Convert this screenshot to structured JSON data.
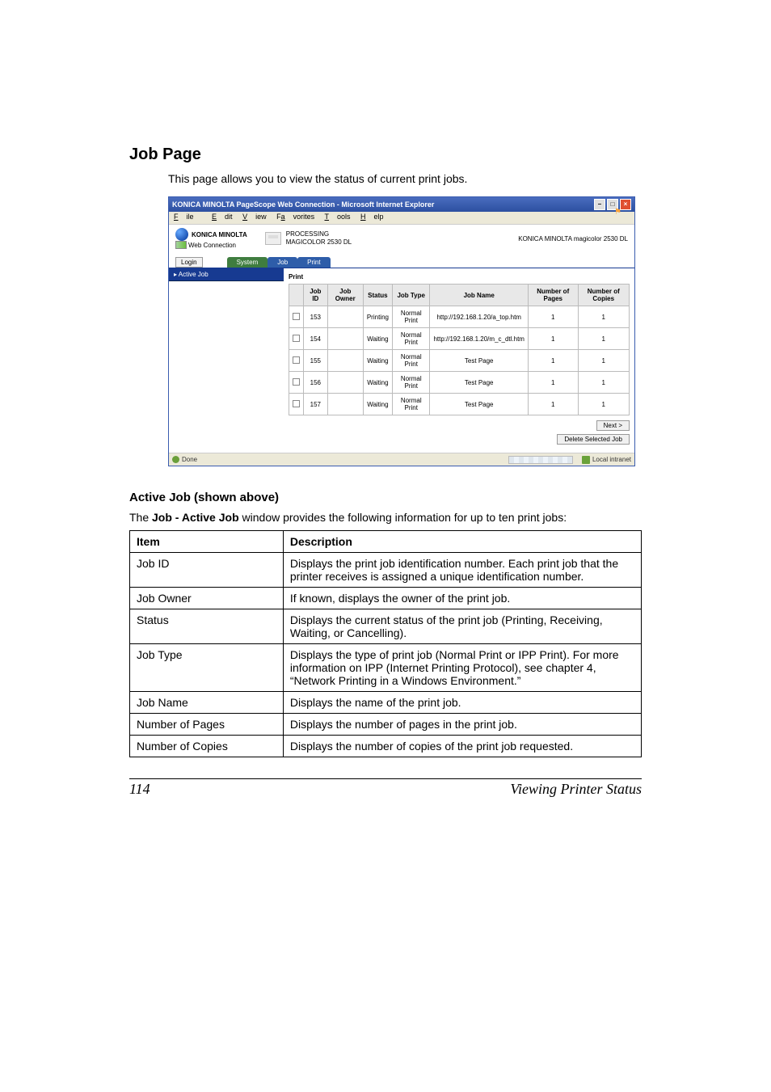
{
  "heading": "Job Page",
  "intro": "This page allows you to view the status of current print jobs.",
  "screenshot": {
    "titlebar": "KONICA MINOLTA PageScope Web Connection - Microsoft Internet Explorer",
    "menubar": {
      "file": "File",
      "edit": "Edit",
      "view": "View",
      "favorites": "Favorites",
      "tools": "Tools",
      "help": "Help"
    },
    "brandName": "KONICA MINOLTA",
    "brandSub": "Web Connection",
    "proc": "PROCESSING",
    "model": "MAGICOLOR 2530 DL",
    "topRight": "KONICA MINOLTA magicolor 2530 DL",
    "loginBtn": "Login",
    "tabs": {
      "system": "System",
      "job": "Job",
      "print": "Print"
    },
    "sideActive": "▸ Active Job",
    "printLabel": "Print",
    "cols": {
      "chk": "",
      "jobid": "Job ID",
      "owner": "Job Owner",
      "status": "Status",
      "type": "Job Type",
      "name": "Job Name",
      "pages": "Number of Pages",
      "copies": "Number of Copies"
    },
    "rows": [
      {
        "id": "153",
        "owner": "",
        "status": "Printing",
        "type": "Normal Print",
        "name": "http://192.168.1.20/a_top.htm",
        "pages": "1",
        "copies": "1"
      },
      {
        "id": "154",
        "owner": "",
        "status": "Waiting",
        "type": "Normal Print",
        "name": "http://192.168.1.20/m_c_dtl.htm",
        "pages": "1",
        "copies": "1"
      },
      {
        "id": "155",
        "owner": "",
        "status": "Waiting",
        "type": "Normal Print",
        "name": "Test Page",
        "pages": "1",
        "copies": "1"
      },
      {
        "id": "156",
        "owner": "",
        "status": "Waiting",
        "type": "Normal Print",
        "name": "Test Page",
        "pages": "1",
        "copies": "1"
      },
      {
        "id": "157",
        "owner": "",
        "status": "Waiting",
        "type": "Normal Print",
        "name": "Test Page",
        "pages": "1",
        "copies": "1"
      }
    ],
    "nextBtn": "Next >",
    "deleteBtn": "Delete Selected Job",
    "statusDone": "Done",
    "statusIntranet": "Local intranet"
  },
  "subhead": "Active Job (shown above)",
  "subpara_prefix": "The ",
  "subpara_bold": "Job - Active Job",
  "subpara_suffix": " window provides the following information for up to ten print jobs:",
  "tableHead": {
    "item": "Item",
    "desc": "Description"
  },
  "tableRows": {
    "r0": {
      "item": "Job ID",
      "desc": "Displays the print job identification number. Each print job that the printer receives is assigned a unique identification number."
    },
    "r1": {
      "item": "Job Owner",
      "desc": "If known, displays the owner of the print job."
    },
    "r2": {
      "item": "Status",
      "desc": "Displays the current status of the print job (Printing, Receiving, Waiting, or Cancelling)."
    },
    "r3": {
      "item": "Job Type",
      "desc": "Displays the type of print job (Normal Print or IPP Print). For more information on IPP (Internet Printing Protocol), see chapter 4, “Network Printing in a Windows Environment.”"
    },
    "r4": {
      "item": "Job Name",
      "desc": "Displays the name of the print job."
    },
    "r5": {
      "item": "Number of Pages",
      "desc": "Displays the number of pages in the print job."
    },
    "r6": {
      "item": "Number of Copies",
      "desc": "Displays the number of copies of the print job requested."
    }
  },
  "footer": {
    "page": "114",
    "text": "Viewing Printer Status"
  }
}
